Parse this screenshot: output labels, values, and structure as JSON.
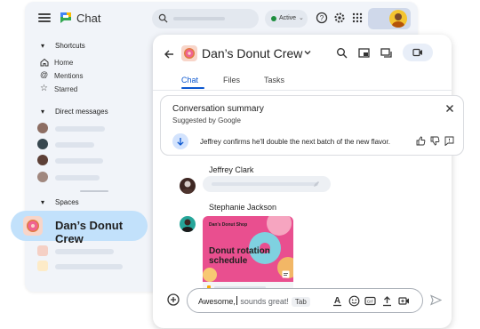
{
  "app": {
    "title": "Chat"
  },
  "topbar": {
    "status": "Active"
  },
  "sidebar": {
    "shortcuts_label": "Shortcuts",
    "shortcuts": [
      {
        "label": "Home",
        "icon": "home-icon"
      },
      {
        "label": "Mentions",
        "icon": "at-icon"
      },
      {
        "label": "Starred",
        "icon": "star-icon"
      }
    ],
    "dm_label": "Direct messages",
    "spaces_label": "Spaces",
    "active_space": "Dan’s Donut Crew"
  },
  "chat": {
    "space_title": "Dan’s Donut Crew",
    "tabs": [
      "Chat",
      "Files",
      "Tasks"
    ],
    "active_tab": "Chat"
  },
  "summary": {
    "title": "Conversation summary",
    "subtitle": "Suggested by Google",
    "text": "Jeffrey confirms he'll double the next batch of the new flavor."
  },
  "messages": [
    {
      "sender": "Jeffrey Clark"
    },
    {
      "sender": "Stephanie Jackson",
      "image": {
        "shop": "Dan's Donut Shop",
        "heading_line1": "Donut rotation",
        "heading_line2": "schedule"
      }
    }
  ],
  "composer": {
    "typed": "Awesome,",
    "suggestion": " sounds great!",
    "tab_hint": "Tab"
  },
  "colors": {
    "accent": "#0b57d0",
    "active_space_bg": "#c2e1fb",
    "status_green": "#1e8e3e"
  }
}
